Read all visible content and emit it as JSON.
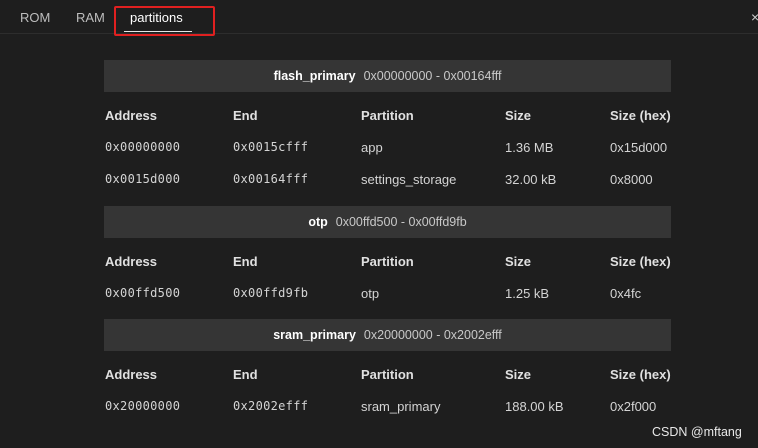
{
  "tabs": [
    {
      "label": "ROM"
    },
    {
      "label": "RAM"
    },
    {
      "label": "partitions"
    }
  ],
  "close_glyph": "×",
  "columns": [
    "Address",
    "End",
    "Partition",
    "Size",
    "Size (hex)"
  ],
  "regions": [
    {
      "name": "flash_primary",
      "range": "0x00000000 - 0x00164fff",
      "rows": [
        {
          "address": "0x00000000",
          "end": "0x0015cfff",
          "partition": "app",
          "size": "1.36 MB",
          "size_hex": "0x15d000"
        },
        {
          "address": "0x0015d000",
          "end": "0x00164fff",
          "partition": "settings_storage",
          "size": "32.00 kB",
          "size_hex": "0x8000"
        }
      ]
    },
    {
      "name": "otp",
      "range": "0x00ffd500 - 0x00ffd9fb",
      "rows": [
        {
          "address": "0x00ffd500",
          "end": "0x00ffd9fb",
          "partition": "otp",
          "size": "1.25 kB",
          "size_hex": "0x4fc"
        }
      ]
    },
    {
      "name": "sram_primary",
      "range": "0x20000000 - 0x2002efff",
      "rows": [
        {
          "address": "0x20000000",
          "end": "0x2002efff",
          "partition": "sram_primary",
          "size": "188.00 kB",
          "size_hex": "0x2f000"
        }
      ]
    }
  ],
  "watermark": "CSDN @mftang",
  "colors": {
    "background": "#1e1e1e",
    "region_bar": "#353535",
    "highlight": "#e02020"
  }
}
